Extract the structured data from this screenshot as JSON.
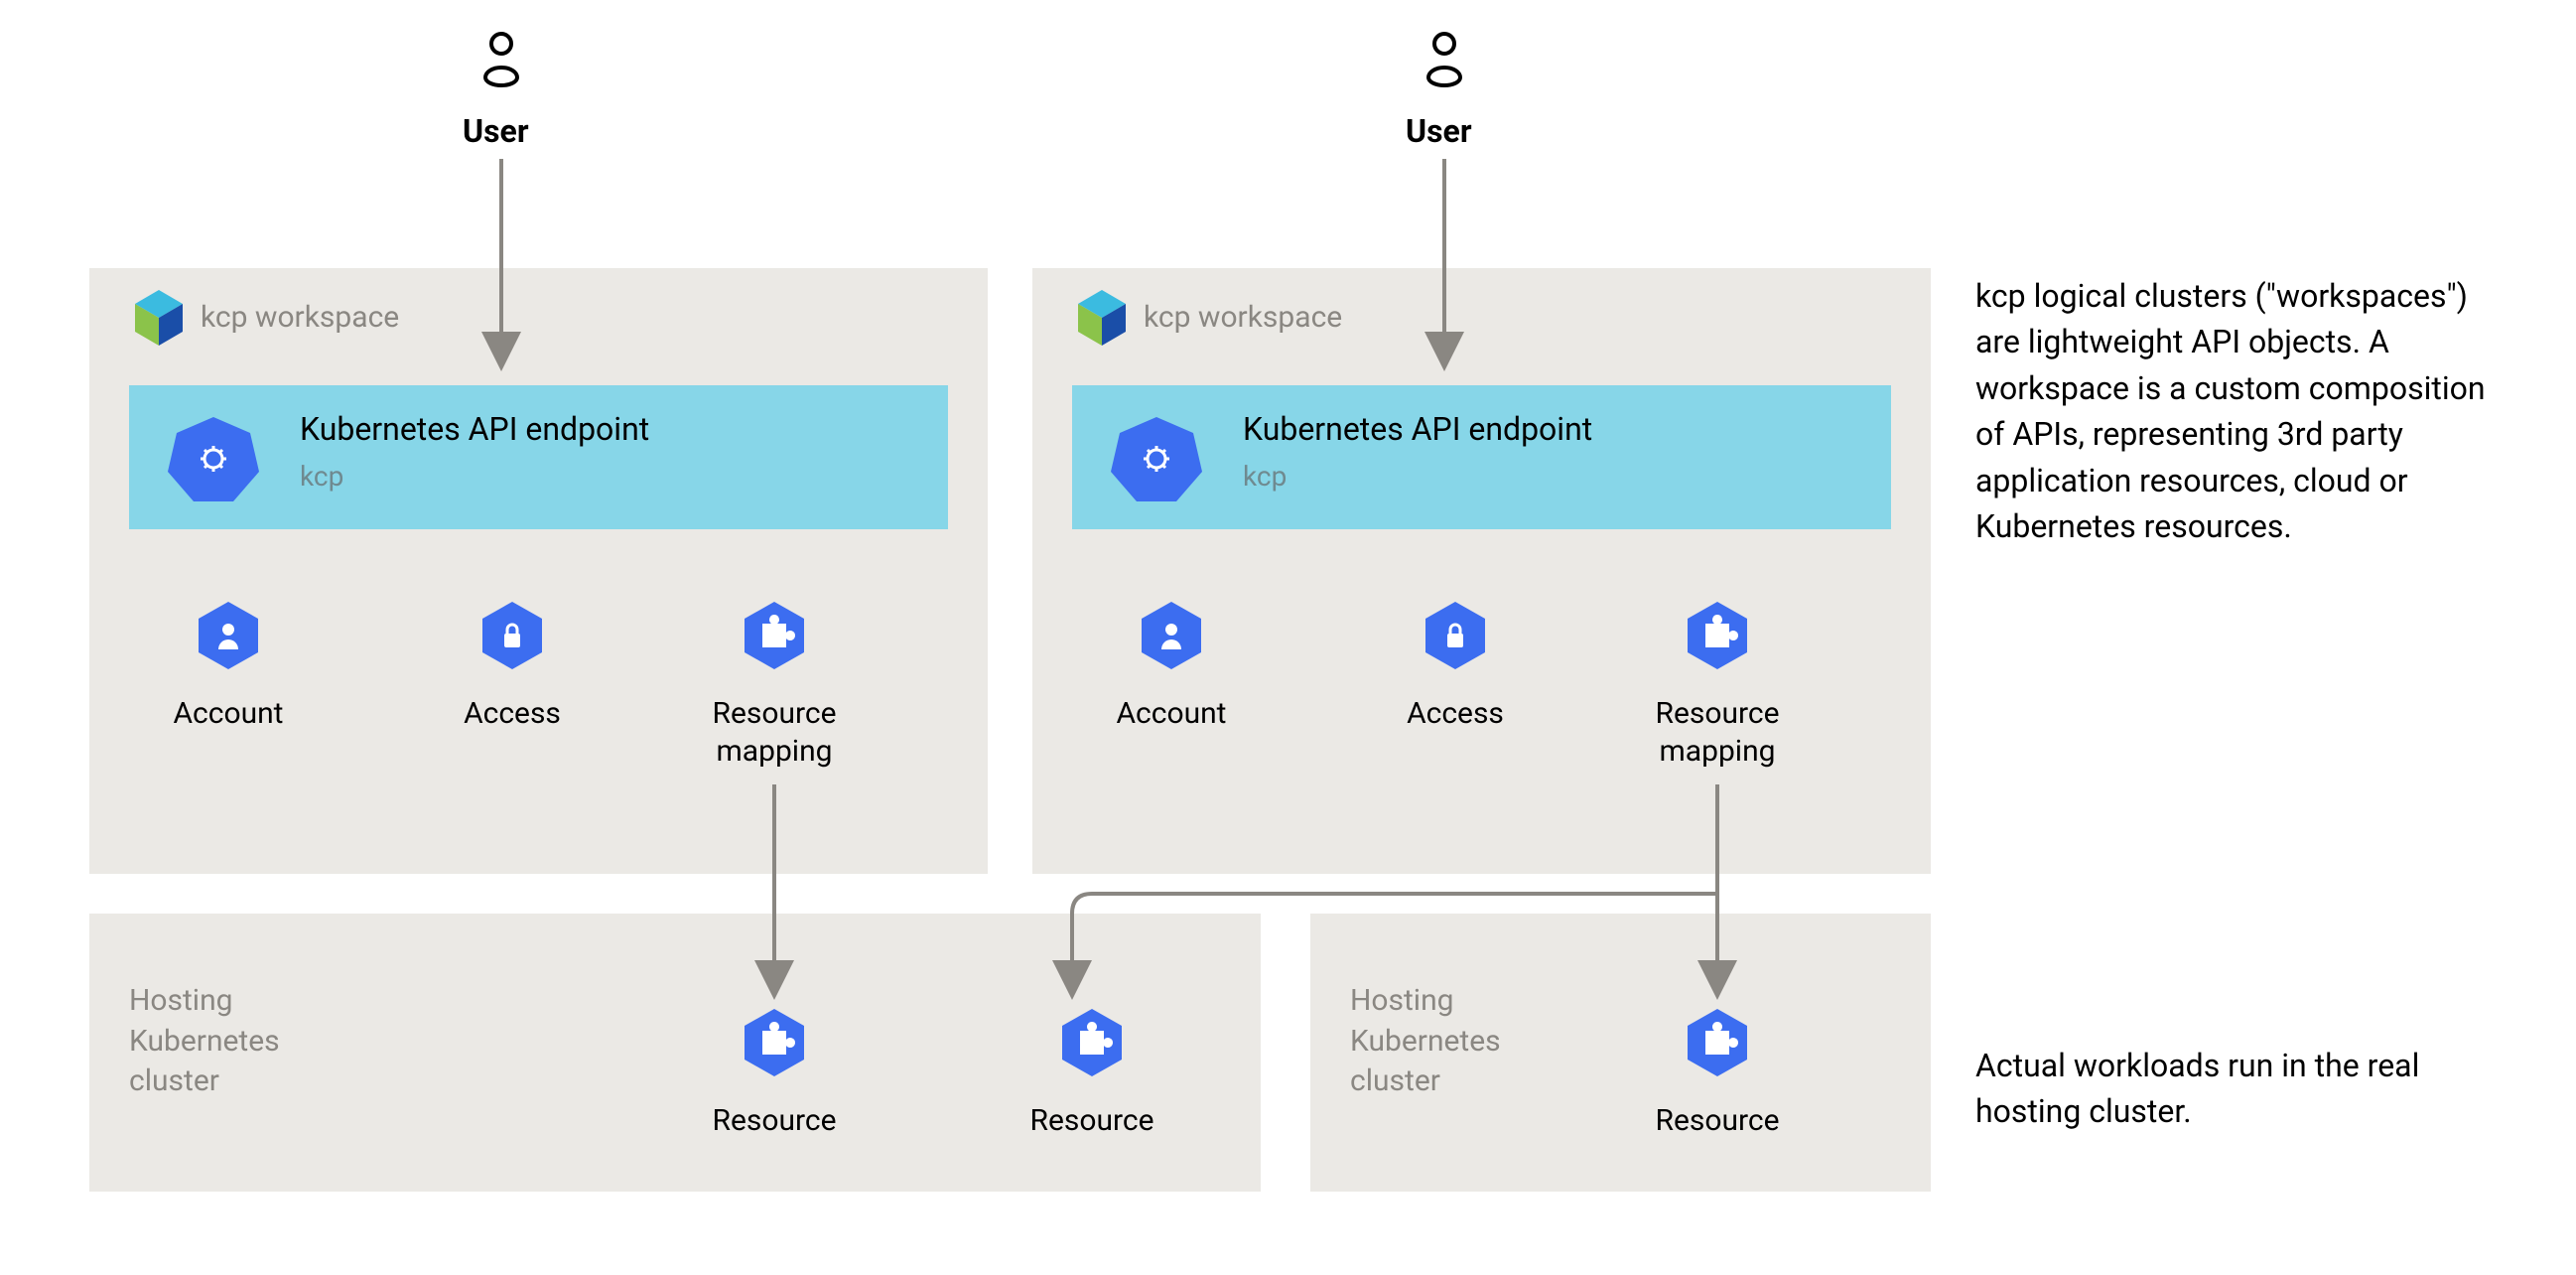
{
  "users": {
    "left": "User",
    "right": "User"
  },
  "workspace_label": "kcp workspace",
  "api_endpoint": {
    "title": "Kubernetes API endpoint",
    "subtitle": "kcp"
  },
  "items": {
    "account": "Account",
    "access": "Access",
    "resource_mapping": "Resource\nmapping",
    "resource": "Resource"
  },
  "hosting_cluster_label": "Hosting\nKubernetes\ncluster",
  "annotations": {
    "upper": "kcp logical clusters (\"workspaces\") are lightweight API objects. A workspace is a custom composition of APIs, representing 3rd party application resources, cloud or Kubernetes resources.",
    "lower": "Actual workloads run in the real hosting cluster."
  },
  "colors": {
    "panel": "#ebe9e5",
    "api_box": "#87d6e8",
    "hex_blue": "#3c6df0",
    "arrow": "#8a8782"
  }
}
